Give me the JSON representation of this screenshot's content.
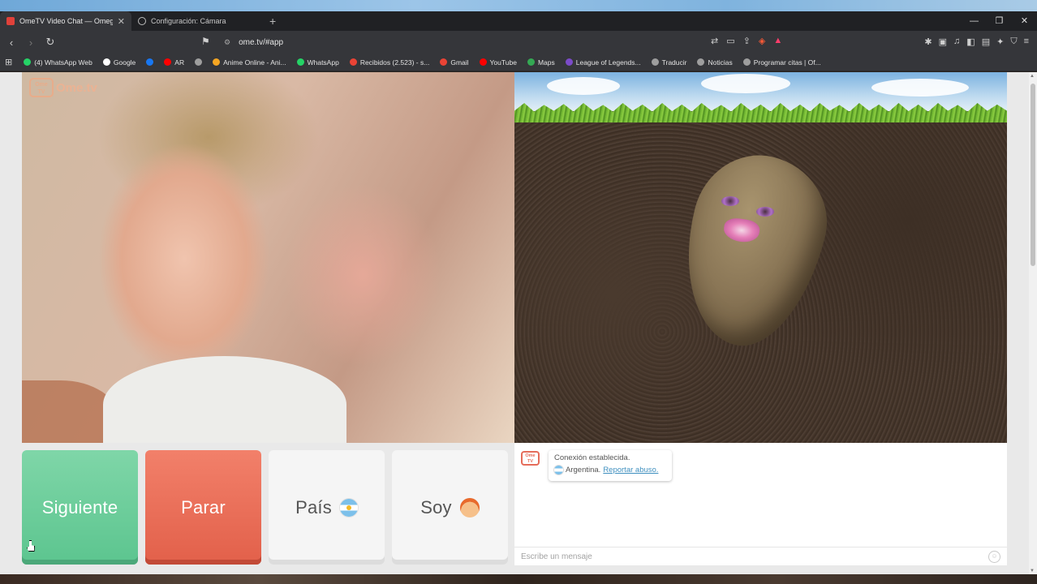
{
  "browser": {
    "tabs": [
      {
        "label": "OmeTV Video Chat — Omeg",
        "active": true
      },
      {
        "label": "Configuración: Cámara",
        "active": false
      }
    ],
    "url": "ome.tv/#app",
    "bookmarks": [
      {
        "label": "(4) WhatsApp Web",
        "color": "#25d366"
      },
      {
        "label": "Google",
        "color": "#ffffff"
      },
      {
        "label": "",
        "color": "#1877f2"
      },
      {
        "label": "AR",
        "color": "#ff0000"
      },
      {
        "label": "",
        "color": "#9e9e9e"
      },
      {
        "label": "Anime Online - Ani...",
        "color": "#f5a623"
      },
      {
        "label": "WhatsApp",
        "color": "#25d366"
      },
      {
        "label": "Recibidos (2.523) - s...",
        "color": "#ea4335"
      },
      {
        "label": "Gmail",
        "color": "#ea4335"
      },
      {
        "label": "YouTube",
        "color": "#ff0000"
      },
      {
        "label": "Maps",
        "color": "#34a853"
      },
      {
        "label": "League of Legends...",
        "color": "#7b4bc9"
      },
      {
        "label": "Traducir",
        "color": "#9e9e9e"
      },
      {
        "label": "Noticias",
        "color": "#9e9e9e"
      },
      {
        "label": "Programar citas | Of...",
        "color": "#9e9e9e"
      }
    ]
  },
  "app": {
    "logo_badge": "Ome TV",
    "logo_text": "Ome.tv",
    "buttons": {
      "next": "Siguiente",
      "stop": "Parar",
      "country": "País",
      "gender": "Soy"
    },
    "chat": {
      "logo_badge": "Ome TV",
      "status": "Conexión establecida.",
      "country": "Argentina.",
      "report": "Reportar abuso.",
      "placeholder": "Escribe un mensaje"
    }
  },
  "colors": {
    "next_button": "#5cc58f",
    "stop_button": "#e2604a",
    "link": "#3e8fbf"
  }
}
